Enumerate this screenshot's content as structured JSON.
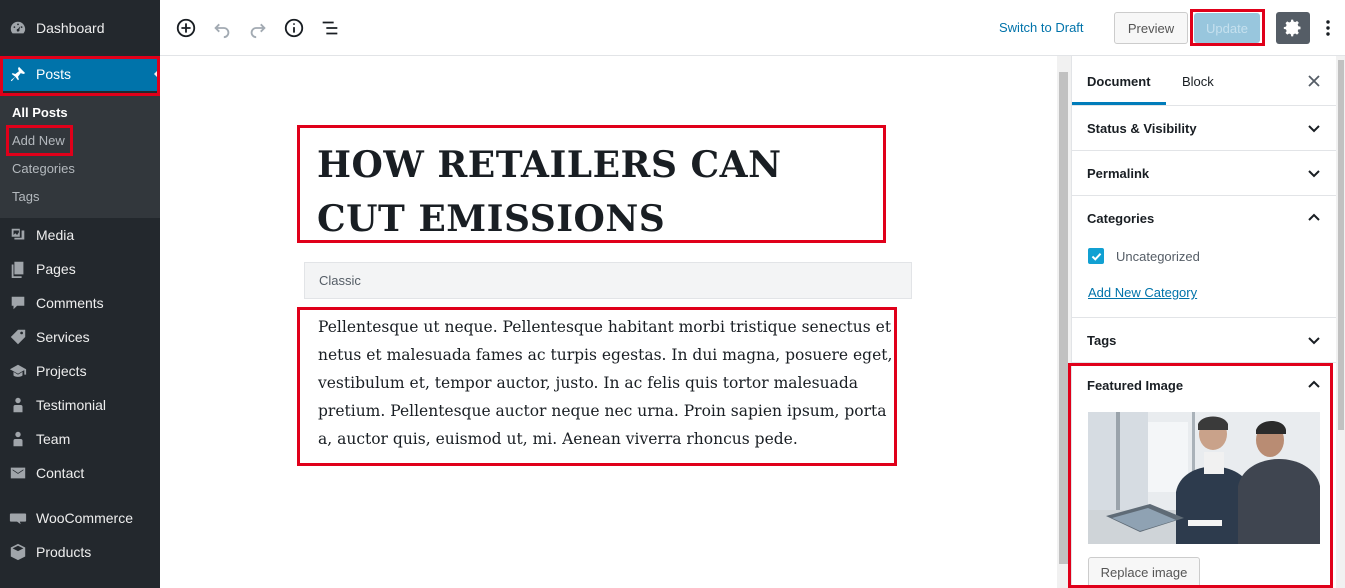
{
  "sidebar": {
    "items": [
      {
        "label": "Dashboard",
        "icon": "dashboard-icon"
      },
      {
        "label": "Posts",
        "icon": "pin-icon"
      },
      {
        "label": "Media",
        "icon": "media-icon"
      },
      {
        "label": "Pages",
        "icon": "pages-icon"
      },
      {
        "label": "Comments",
        "icon": "comments-icon"
      },
      {
        "label": "Services",
        "icon": "tag-icon"
      },
      {
        "label": "Projects",
        "icon": "graduation-cap-icon"
      },
      {
        "label": "Testimonial",
        "icon": "person-icon"
      },
      {
        "label": "Team",
        "icon": "person-icon"
      },
      {
        "label": "Contact",
        "icon": "envelope-icon"
      },
      {
        "label": "WooCommerce",
        "icon": "woo-icon"
      },
      {
        "label": "Products",
        "icon": "box-icon"
      }
    ],
    "submenu": [
      "All Posts",
      "Add New",
      "Categories",
      "Tags"
    ]
  },
  "toolbar": {
    "switch_draft": "Switch to Draft",
    "preview": "Preview",
    "update": "Update"
  },
  "editor": {
    "title": "HOW RETAILERS CAN CUT EMISSIONS",
    "classic_label": "Classic",
    "body": "Pellentesque ut neque. Pellentesque habitant morbi tristique senectus et netus et malesuada fames ac turpis egestas. In dui magna, posuere eget, vestibulum et, tempor auctor, justo. In ac felis quis tortor malesuada pretium. Pellentesque auctor neque nec urna. Proin sapien ipsum, porta a, auctor quis, euismod ut, mi. Aenean viverra rhoncus pede."
  },
  "settings": {
    "tabs": [
      "Document",
      "Block"
    ],
    "panels": {
      "status": "Status & Visibility",
      "permalink": "Permalink",
      "categories": "Categories",
      "tags": "Tags",
      "featured": "Featured Image"
    },
    "category_option": "Uncategorized",
    "add_category": "Add New Category",
    "replace_image": "Replace image"
  },
  "colors": {
    "sidebar_bg": "#23282d",
    "active_blue": "#0073aa",
    "highlight_red": "#e0001a"
  }
}
